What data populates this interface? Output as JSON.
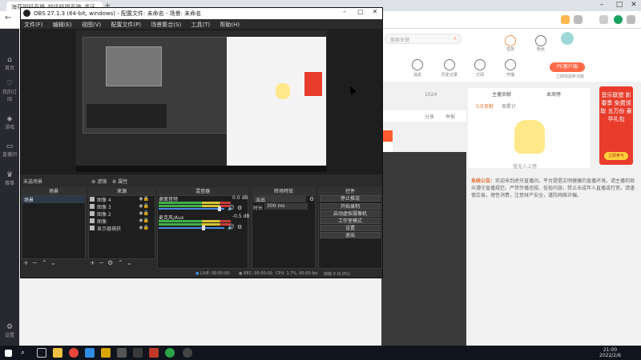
{
  "browser": {
    "tab_title": "海燕瑚班直播_超级联盟直播_虎牙",
    "new_tab": "+",
    "window_controls": {
      "minimize": "–",
      "maximize": "□",
      "close": "✕"
    }
  },
  "sidebar": {
    "items": [
      {
        "label": "首页",
        "icon": "home-icon"
      },
      {
        "label": "我的订阅",
        "icon": "subscribe-icon"
      },
      {
        "label": "游戏",
        "icon": "game-icon"
      },
      {
        "label": "直播间",
        "icon": "tv-icon"
      },
      {
        "label": "赛事",
        "icon": "trophy-icon"
      },
      {
        "label": "设置",
        "icon": "gear-icon"
      }
    ]
  },
  "webpage": {
    "search_placeholder": "搜索关键",
    "nav_items": [
      {
        "label": "消息"
      },
      {
        "label": "历史记录"
      },
      {
        "label": "订阅"
      },
      {
        "label": "开播"
      },
      {
        "label": "任务"
      },
      {
        "label": "粉丝"
      }
    ],
    "pc_button": "PC客户端",
    "pc_sub": "立即体验新功能",
    "rank_tabs": [
      "主播贡献",
      "本周榜"
    ],
    "rank_subtabs": [
      "5点贡献",
      "周累计"
    ],
    "mascot_caption": "暂无人上榜",
    "msg_row_text": "1024",
    "msg_labels": [
      "分享",
      "举报"
    ],
    "ad_text": "音乐联盟 新春季 免费领取 五万份 豪华礼包",
    "ad_button": "立即参与",
    "notice_prefix": "系统公告：",
    "notice_body": "欢迎来到虎牙直播间，平台提倡文明健康的直播环境，请主播和观众遵守直播规范，严禁传播违规、低俗内容，禁止未成年人直播或打赏。请谨慎交易，理性消费，注意财产安全，谨防网络诈骗。"
  },
  "obs": {
    "title": "OBS 27.1.3 (64-bit, windows) - 配置文件: 未命名 - 场景: 未命名",
    "menu": [
      "文件(F)",
      "编辑(E)",
      "视图(V)",
      "配置文件(P)",
      "场景集合(S)",
      "工具(T)",
      "帮助(H)"
    ],
    "scene_bar_label": "未选场景",
    "scene_bar_toggles": [
      "滤镜",
      "属性"
    ],
    "docks": {
      "scenes": "场景",
      "sources": "来源",
      "mixer": "混音器",
      "transitions": "转场特效",
      "controls": "控件"
    },
    "scene_item": "场景",
    "sources": [
      {
        "name": "图像 4"
      },
      {
        "name": "图像 3"
      },
      {
        "name": "图像 2"
      },
      {
        "name": "图像"
      },
      {
        "name": "显示器捕获"
      }
    ],
    "mixer_tracks": [
      {
        "name": "桌面音频",
        "db": "0.0 dB",
        "level": 0.93
      },
      {
        "name": "麦克风/Aux",
        "db": "-0.5 dB",
        "level": 0.68
      }
    ],
    "transition": {
      "selected": "淡出",
      "duration_label": "时长",
      "duration_value": "300 ms"
    },
    "control_buttons": [
      "停止推流",
      "开始录制",
      "启动虚拟摄像机",
      "工作室模式",
      "设置",
      "退出"
    ],
    "status": {
      "live": "LIVE: 00:00:00",
      "rec": "REC: 00:00:00",
      "cpu": "CPU: 1.7%, 60.00 fps",
      "dropped": "掉帧 0 (0.0%)"
    }
  },
  "taskbar": {
    "time": "21:00",
    "date": "2022/2/6"
  },
  "colors": {
    "sidebar": "#28282f",
    "accent_orange": "#ff6b4a",
    "obs_bg": "#2b2b2b",
    "meter_green": "#3fae49",
    "meter_yellow": "#d6c533",
    "meter_red": "#c83b3b"
  }
}
